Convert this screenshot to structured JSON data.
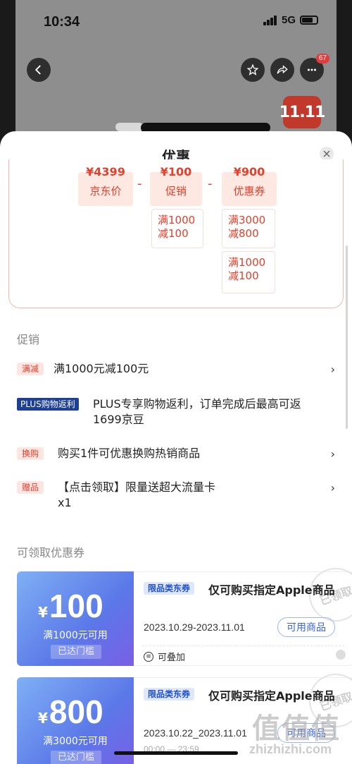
{
  "status_bar": {
    "time": "10:34",
    "network": "5G"
  },
  "nav": {
    "cart_badge": "67",
    "event_logo": "11.11"
  },
  "sheet": {
    "title": "优惠",
    "breakdown": {
      "price_amount": "¥4399",
      "price_label": "京东价",
      "promo_amount": "¥100",
      "promo_label": "促销",
      "coupon_amount": "¥900",
      "coupon_label": "优惠券",
      "operator": "-",
      "promo_deals": [
        "满1000\n减100"
      ],
      "coupon_deals": [
        "满3000\n减800",
        "满1000\n减100"
      ]
    },
    "promotions": {
      "title": "促销",
      "items": [
        {
          "tag": "满减",
          "text": "满1000元减100元"
        },
        {
          "tag": "PLUS购物返利",
          "text": "PLUS专享购物返利，订单完成后最高可返1699京豆"
        },
        {
          "tag": "换购",
          "text": "购买1件可优惠换购热销商品"
        },
        {
          "tag": "赠品",
          "text": "【点击领取】限量送超大流量卡\nx1"
        }
      ]
    },
    "coupons": {
      "title": "可领取优惠券",
      "items": [
        {
          "symbol": "¥",
          "value": "100",
          "condition": "满1000元可用",
          "status": "已达门槛",
          "tag": "限品类东券",
          "name": "仅可购买指定Apple商品",
          "date": "2023.10.29-2023.11.01",
          "button": "可用商品",
          "stack": "可叠加",
          "stamp": "已领取"
        },
        {
          "symbol": "¥",
          "value": "800",
          "condition": "满3000元可用",
          "status": "已达门槛",
          "tag": "限品类东券",
          "name": "仅可购买指定Apple商品",
          "date": "2023.10.22_2023.11.01",
          "button": "可用商品",
          "time_partial": "00:00 — 23:59",
          "stamp": "已领取"
        }
      ]
    }
  },
  "watermark": {
    "glyphs": "值值值",
    "site": "zhizhizhi.com"
  }
}
